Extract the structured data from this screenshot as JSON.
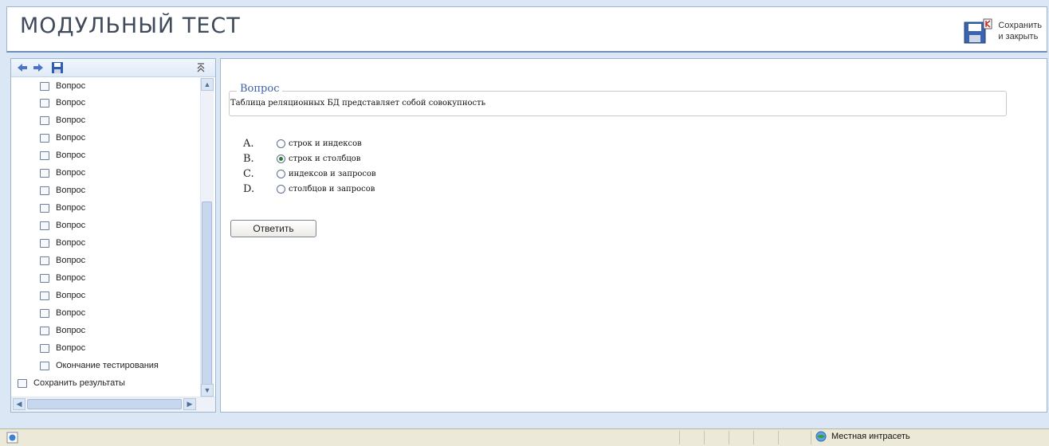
{
  "header": {
    "title": "МОДУЛЬНЫЙ ТЕСТ",
    "save_close_line1": "Сохранить",
    "save_close_line2": "и закрыть"
  },
  "sidebar": {
    "toolbar_icons": [
      "back-arrow-icon",
      "forward-arrow-icon",
      "floppy-disk-icon",
      "collapse-icon"
    ],
    "items": [
      {
        "label": "Вопрос"
      },
      {
        "label": "Вопрос"
      },
      {
        "label": "Вопрос"
      },
      {
        "label": "Вопрос"
      },
      {
        "label": "Вопрос"
      },
      {
        "label": "Вопрос"
      },
      {
        "label": "Вопрос"
      },
      {
        "label": "Вопрос"
      },
      {
        "label": "Вопрос"
      },
      {
        "label": "Вопрос"
      },
      {
        "label": "Вопрос"
      },
      {
        "label": "Вопрос"
      },
      {
        "label": "Вопрос"
      },
      {
        "label": "Вопрос"
      },
      {
        "label": "Вопрос"
      },
      {
        "label": "Вопрос"
      },
      {
        "label": "Окончание тестирования"
      },
      {
        "label": "Сохранить результаты"
      }
    ]
  },
  "main": {
    "legend": "Вопрос",
    "question": "Таблица реляционных БД представляет собой совокупность",
    "answers": [
      {
        "letter": "A.",
        "text": "строк и индексов",
        "selected": false
      },
      {
        "letter": "B.",
        "text": "строк и столбцов",
        "selected": true
      },
      {
        "letter": "C.",
        "text": "индексов и запросов",
        "selected": false
      },
      {
        "letter": "D.",
        "text": "столбцов и запросов",
        "selected": false
      }
    ],
    "submit_label": "Ответить"
  },
  "statusbar": {
    "zone_label": "Местная интрасеть"
  },
  "colors": {
    "accent": "#3b5fa8",
    "background": "#dbe7f5",
    "border": "#9fb5cf"
  }
}
